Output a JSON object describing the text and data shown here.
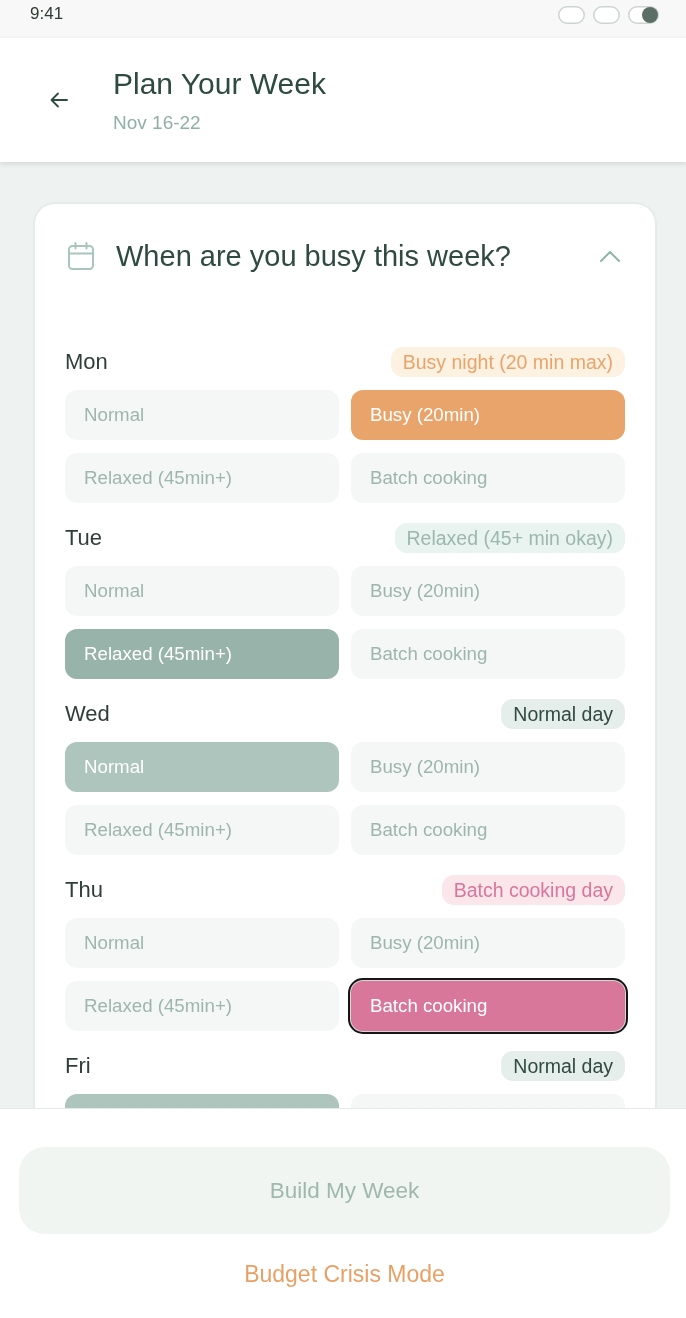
{
  "status_bar": {
    "time": "9:41"
  },
  "header": {
    "title": "Plan Your Week",
    "subtitle": "Nov 16-22"
  },
  "section": {
    "title": "When are you busy this week?",
    "expanded": true,
    "days": [
      {
        "day": "Mon",
        "badge": {
          "text": "Busy night (20 min max)",
          "kind": "busy"
        },
        "options": [
          {
            "label": "Normal",
            "kind": "normal",
            "selected": false,
            "focused": false
          },
          {
            "label": "Busy (20min)",
            "kind": "busy",
            "selected": true,
            "focused": false
          },
          {
            "label": "Relaxed (45min+)",
            "kind": "relaxed",
            "selected": false,
            "focused": false
          },
          {
            "label": "Batch cooking",
            "kind": "batch",
            "selected": false,
            "focused": false
          }
        ]
      },
      {
        "day": "Tue",
        "badge": {
          "text": "Relaxed (45+ min okay)",
          "kind": "relaxed"
        },
        "options": [
          {
            "label": "Normal",
            "kind": "normal",
            "selected": false,
            "focused": false
          },
          {
            "label": "Busy (20min)",
            "kind": "busy",
            "selected": false,
            "focused": false
          },
          {
            "label": "Relaxed (45min+)",
            "kind": "relaxed",
            "selected": true,
            "focused": false
          },
          {
            "label": "Batch cooking",
            "kind": "batch",
            "selected": false,
            "focused": false
          }
        ]
      },
      {
        "day": "Wed",
        "badge": {
          "text": "Normal day",
          "kind": "normal"
        },
        "options": [
          {
            "label": "Normal",
            "kind": "normal",
            "selected": true,
            "focused": false
          },
          {
            "label": "Busy (20min)",
            "kind": "busy",
            "selected": false,
            "focused": false
          },
          {
            "label": "Relaxed (45min+)",
            "kind": "relaxed",
            "selected": false,
            "focused": false
          },
          {
            "label": "Batch cooking",
            "kind": "batch",
            "selected": false,
            "focused": false
          }
        ]
      },
      {
        "day": "Thu",
        "badge": {
          "text": "Batch cooking day",
          "kind": "batch"
        },
        "options": [
          {
            "label": "Normal",
            "kind": "normal",
            "selected": false,
            "focused": false
          },
          {
            "label": "Busy (20min)",
            "kind": "busy",
            "selected": false,
            "focused": false
          },
          {
            "label": "Relaxed (45min+)",
            "kind": "relaxed",
            "selected": false,
            "focused": false
          },
          {
            "label": "Batch cooking",
            "kind": "batch",
            "selected": true,
            "focused": true
          }
        ]
      },
      {
        "day": "Fri",
        "badge": {
          "text": "Normal day",
          "kind": "normal"
        },
        "options": [
          {
            "kind": "normal",
            "selected": true,
            "focused": false
          },
          {
            "kind": "busy",
            "selected": false,
            "focused": false
          }
        ]
      }
    ]
  },
  "footer": {
    "build_button": {
      "label": "Build My Week",
      "disabled": true
    },
    "link": "Budget Crisis Mode"
  }
}
